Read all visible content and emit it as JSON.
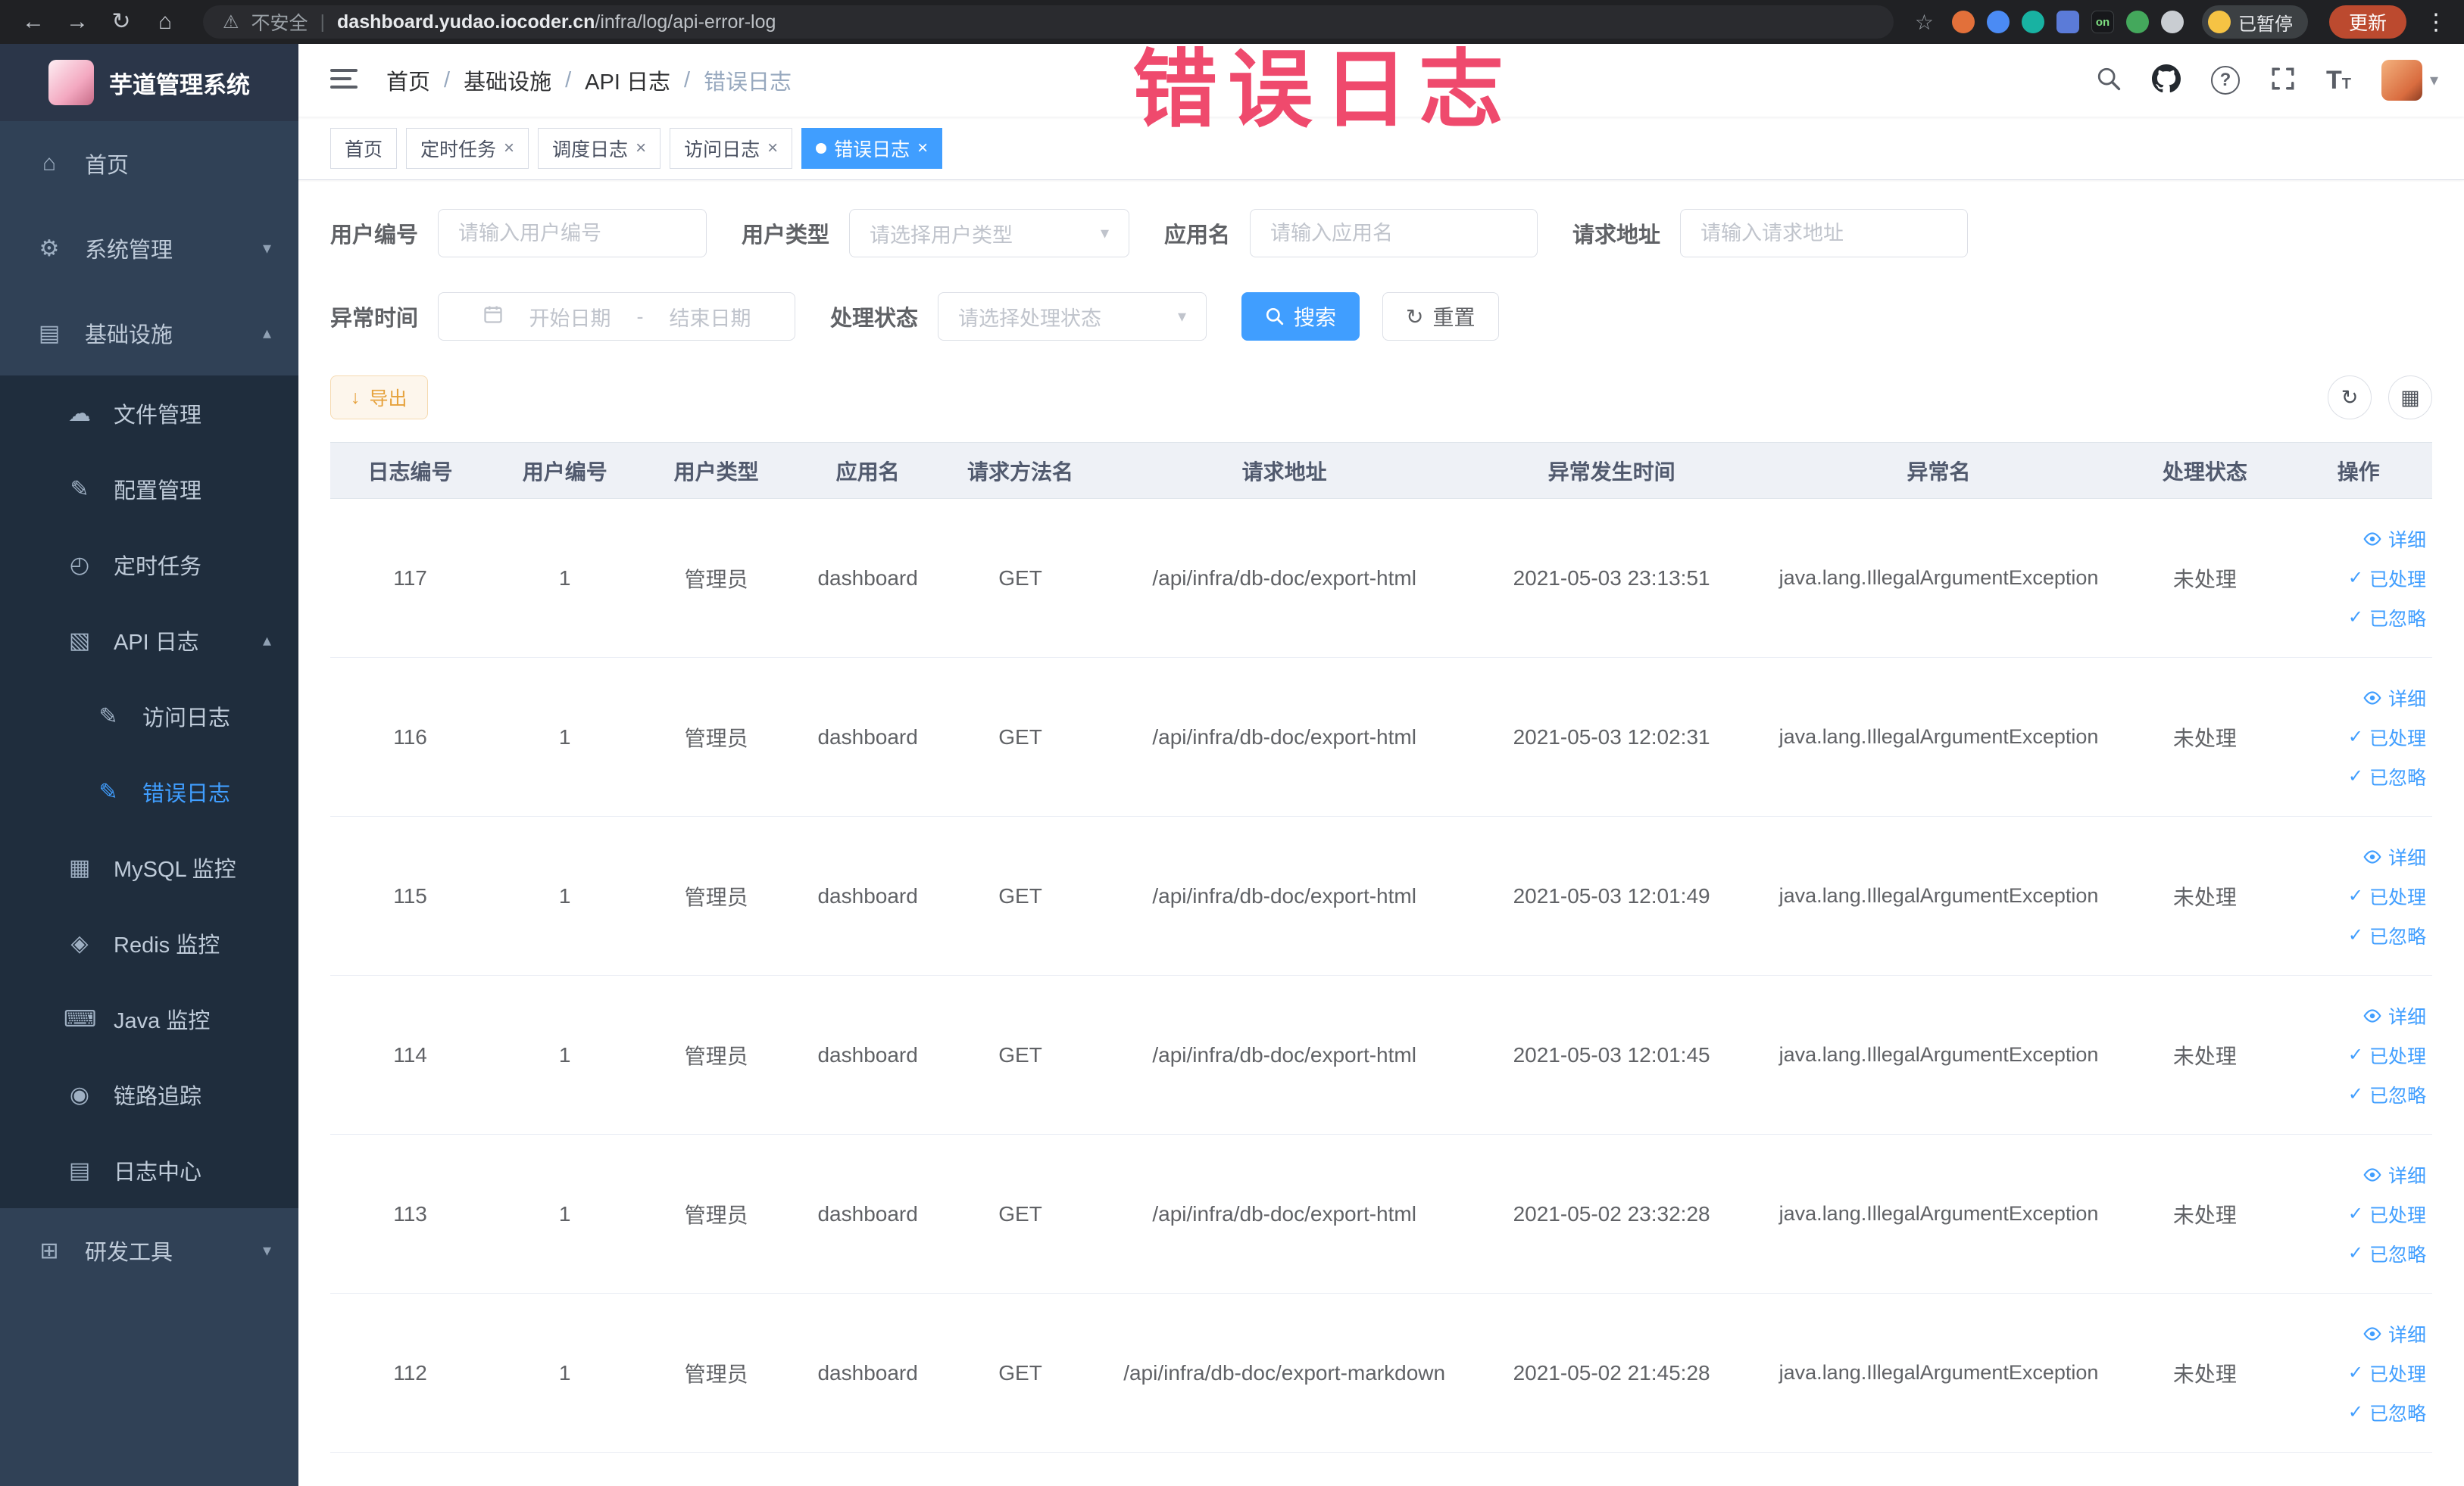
{
  "watermark": "错误日志",
  "browser": {
    "security": "不安全",
    "divider": "|",
    "url_domain": "dashboard.yudao.iocoder.cn",
    "url_path": "/infra/log/api-error-log",
    "ext_on": "on",
    "paused": "已暂停",
    "update": "更新"
  },
  "sidebar": {
    "title": "芋道管理系统",
    "items": {
      "home": "首页",
      "system": "系统管理",
      "infra": "基础设施",
      "dev_tools": "研发工具"
    },
    "infra_children": {
      "file": "文件管理",
      "config": "配置管理",
      "job": "定时任务",
      "api_log": "API 日志",
      "mysql": "MySQL 监控",
      "redis": "Redis 监控",
      "java": "Java 监控",
      "trace": "链路追踪",
      "log_center": "日志中心"
    },
    "api_log_children": {
      "access_log": "访问日志",
      "error_log": "错误日志"
    }
  },
  "breadcrumb": [
    "首页",
    "基础设施",
    "API 日志",
    "错误日志"
  ],
  "ui": {
    "breadcrumb_separator": "/"
  },
  "tabs": [
    {
      "label": "首页"
    },
    {
      "label": "定时任务"
    },
    {
      "label": "调度日志"
    },
    {
      "label": "访问日志"
    },
    {
      "label": "错误日志"
    }
  ],
  "filters": {
    "user_id_label": "用户编号",
    "user_id_placeholder": "请输入用户编号",
    "user_type_label": "用户类型",
    "user_type_placeholder": "请选择用户类型",
    "app_name_label": "应用名",
    "app_name_placeholder": "请输入应用名",
    "request_url_label": "请求地址",
    "request_url_placeholder": "请输入请求地址",
    "exception_time_label": "异常时间",
    "date_start_placeholder": "开始日期",
    "date_separator": "-",
    "date_end_placeholder": "结束日期",
    "process_status_label": "处理状态",
    "process_status_placeholder": "请选择处理状态",
    "search_button": "搜索",
    "reset_button": "重置"
  },
  "toolbar": {
    "export_button": "导出"
  },
  "table": {
    "columns": [
      "日志编号",
      "用户编号",
      "用户类型",
      "应用名",
      "请求方法名",
      "请求地址",
      "异常发生时间",
      "异常名",
      "处理状态",
      "操作"
    ],
    "actions": {
      "detail": "详细",
      "processed": "已处理",
      "ignored": "已忽略"
    },
    "rows": [
      {
        "log_id": "117",
        "user_id": "1",
        "user_type": "管理员",
        "app_name": "dashboard",
        "method": "GET",
        "url": "/api/infra/db-doc/export-html",
        "time": "2021-05-03 23:13:51",
        "exception": "java.lang.IllegalArgumentException",
        "status": "未处理"
      },
      {
        "log_id": "116",
        "user_id": "1",
        "user_type": "管理员",
        "app_name": "dashboard",
        "method": "GET",
        "url": "/api/infra/db-doc/export-html",
        "time": "2021-05-03 12:02:31",
        "exception": "java.lang.IllegalArgumentException",
        "status": "未处理"
      },
      {
        "log_id": "115",
        "user_id": "1",
        "user_type": "管理员",
        "app_name": "dashboard",
        "method": "GET",
        "url": "/api/infra/db-doc/export-html",
        "time": "2021-05-03 12:01:49",
        "exception": "java.lang.IllegalArgumentException",
        "status": "未处理"
      },
      {
        "log_id": "114",
        "user_id": "1",
        "user_type": "管理员",
        "app_name": "dashboard",
        "method": "GET",
        "url": "/api/infra/db-doc/export-html",
        "time": "2021-05-03 12:01:45",
        "exception": "java.lang.IllegalArgumentException",
        "status": "未处理"
      },
      {
        "log_id": "113",
        "user_id": "1",
        "user_type": "管理员",
        "app_name": "dashboard",
        "method": "GET",
        "url": "/api/infra/db-doc/export-html",
        "time": "2021-05-02 23:32:28",
        "exception": "java.lang.IllegalArgumentException",
        "status": "未处理"
      },
      {
        "log_id": "112",
        "user_id": "1",
        "user_type": "管理员",
        "app_name": "dashboard",
        "method": "GET",
        "url": "/api/infra/db-doc/export-markdown",
        "time": "2021-05-02 21:45:28",
        "exception": "java.lang.IllegalArgumentException",
        "status": "未处理"
      }
    ]
  },
  "icons": {
    "back": "←",
    "forward": "→",
    "reload": "↻",
    "home": "⌂",
    "warning": "⚠",
    "star": "☆",
    "kebab": "⋮",
    "menu_home": "⌂",
    "gear": "⚙",
    "infra": "▤",
    "file": "☁",
    "config": "✎",
    "task": "◴",
    "api_log": "▧",
    "doc_edit": "✎",
    "mysql": "▦",
    "redis": "◈",
    "java": "⌨",
    "trace": "◉",
    "log_center": "▤",
    "dev": "⊞",
    "chev_down": "▾",
    "chev_up": "▴",
    "caret": "▾",
    "close": "×",
    "check": "✓",
    "refresh": "↻",
    "grid": "▦",
    "download": "↓"
  },
  "colors": {
    "accent": "#409EFF",
    "warning": "#e6a23c",
    "watermark": "#ee3c62",
    "sidebar_bg": "#304156",
    "submenu_bg": "#1f2d3d"
  }
}
